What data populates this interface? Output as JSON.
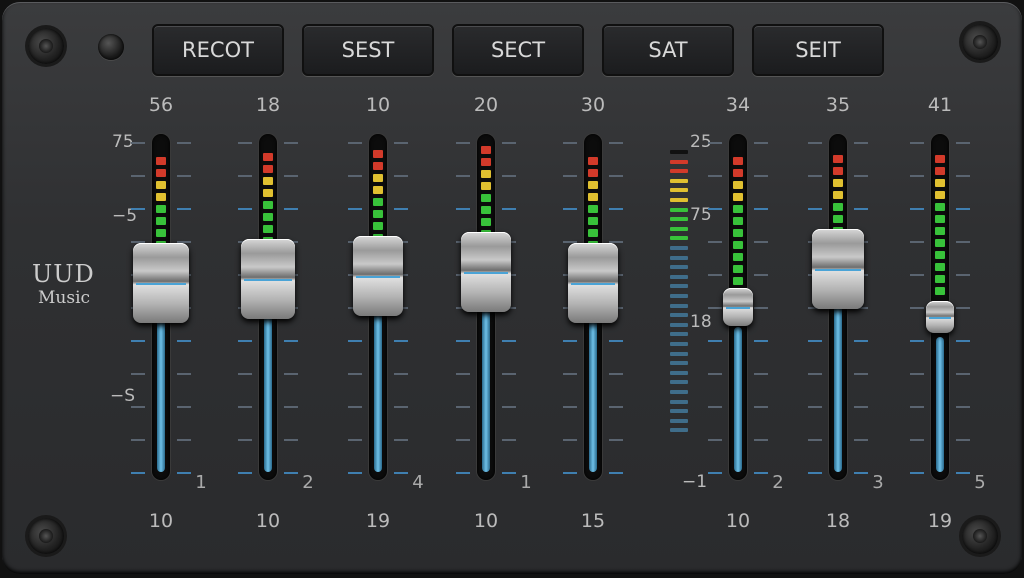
{
  "buttons": [
    "RECOT",
    "SEST",
    "SECT",
    "SAT",
    "SEIT"
  ],
  "logo": {
    "line1": "UUD",
    "line2": "Music"
  },
  "scale_left": [
    "75",
    "−5",
    "−S"
  ],
  "scale_mid": [
    "25",
    "75",
    "18",
    "−1"
  ],
  "channels": [
    {
      "top": "56",
      "bottom": "10",
      "num": "1",
      "level": 0.57
    },
    {
      "top": "18",
      "bottom": "10",
      "num": "2",
      "level": 0.58
    },
    {
      "top": "10",
      "bottom": "19",
      "num": "4",
      "level": 0.59
    },
    {
      "top": "20",
      "bottom": "10",
      "num": "1",
      "level": 0.6
    },
    {
      "top": "30",
      "bottom": "15",
      "num": "",
      "level": 0.57
    },
    {
      "top": "34",
      "bottom": "10",
      "num": "2",
      "level": 0.5
    },
    {
      "top": "35",
      "bottom": "18",
      "num": "3",
      "level": 0.61
    },
    {
      "top": "41",
      "bottom": "19",
      "num": "5",
      "level": 0.47
    }
  ],
  "colors": {
    "meter_red": "#d23a2a",
    "meter_green": "#38c23a",
    "meter_yellow": "#e0c030",
    "fader_blue": "#5ab4e0"
  }
}
